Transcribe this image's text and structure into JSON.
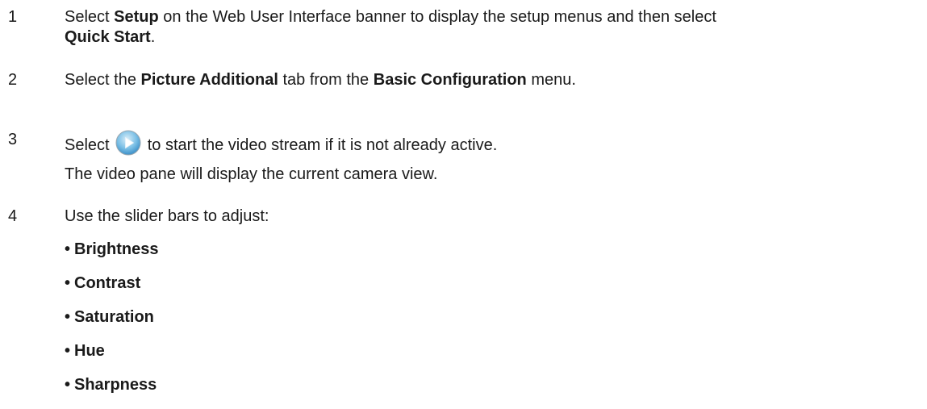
{
  "steps": [
    {
      "number": "1",
      "parts": [
        "Select ",
        "Setup",
        " on the Web User Interface banner to display the setup menus and then select ",
        "Quick Start",
        "."
      ]
    },
    {
      "number": "2",
      "parts": [
        "Select the ",
        "Picture Additional",
        " tab from the ",
        "Basic Configuration",
        " menu."
      ]
    },
    {
      "number": "3",
      "before_icon": "Select",
      "icon": "play-icon",
      "after_icon": "to start the video stream if it is not already active.",
      "note": "The video pane will display the current camera view."
    },
    {
      "number": "4",
      "text": "Use the slider bars to adjust:",
      "bullet_glyph": "•",
      "bullets": [
        "Brightness",
        "Contrast",
        "Saturation",
        "Hue",
        "Sharpness"
      ]
    }
  ],
  "colors": {
    "text": "#1a1a1a",
    "icon_blue": "#3a9bd8"
  }
}
